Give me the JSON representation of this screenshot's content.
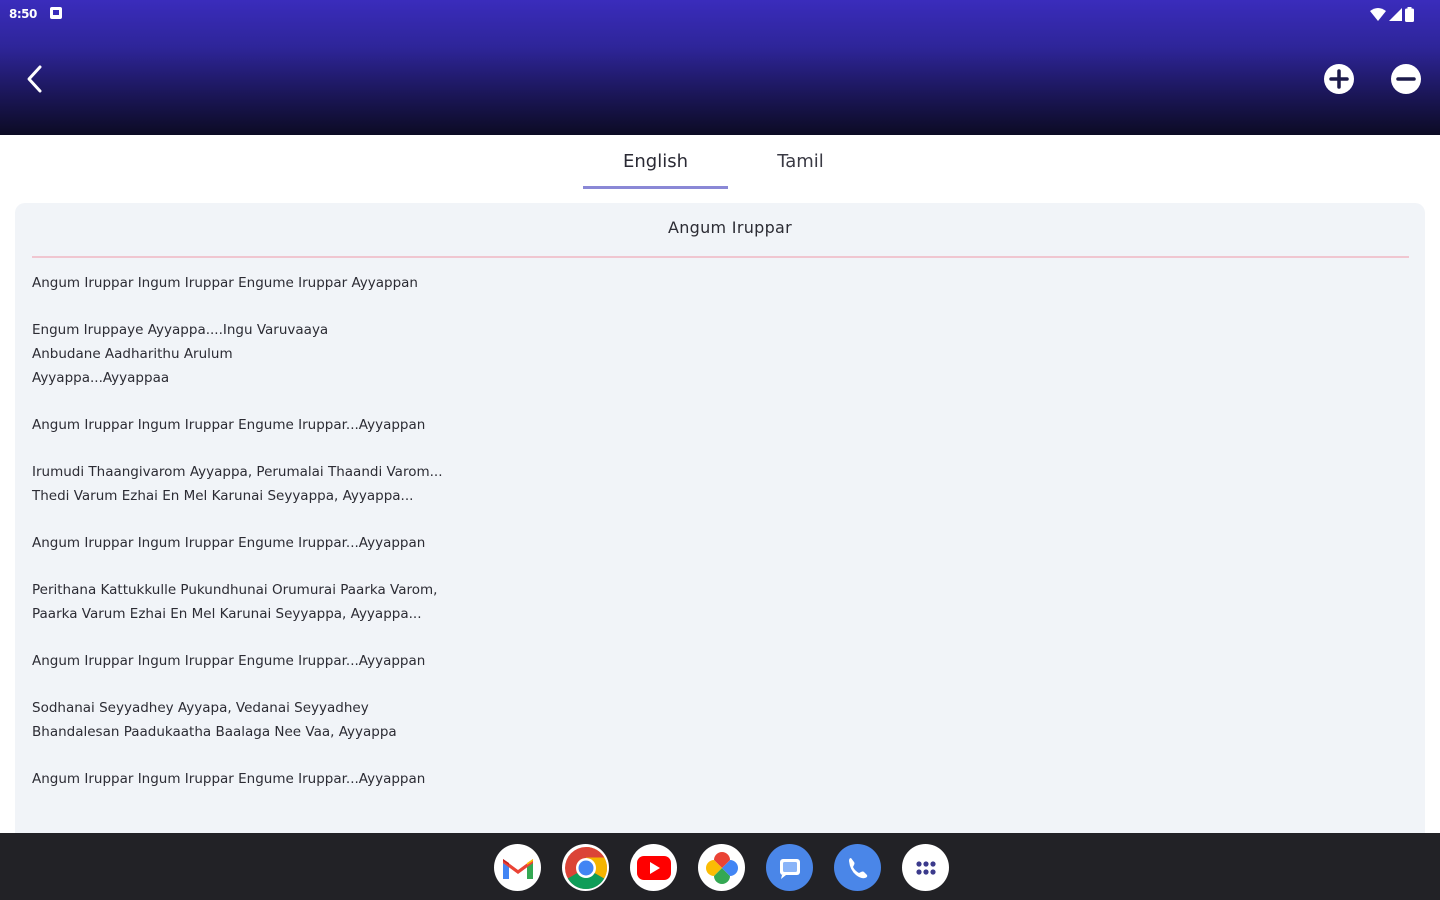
{
  "status_bar": {
    "time": "8:50"
  },
  "tabs": [
    {
      "label": "English",
      "active": true
    },
    {
      "label": "Tamil",
      "active": false
    }
  ],
  "song": {
    "title": "Angum Iruppar",
    "stanzas": [
      [
        "Angum Iruppar Ingum Iruppar Engume Iruppar Ayyappan"
      ],
      [
        "Engum Iruppaye Ayyappa....Ingu Varuvaaya",
        "Anbudane Aadharithu Arulum",
        "Ayyappa...Ayyappaa"
      ],
      [
        "Angum Iruppar Ingum Iruppar Engume Iruppar...Ayyappan"
      ],
      [
        "Irumudi Thaangivarom Ayyappa, Perumalai Thaandi Varom...",
        "Thedi Varum Ezhai En Mel Karunai Seyyappa, Ayyappa..."
      ],
      [
        "Angum Iruppar Ingum Iruppar Engume Iruppar...Ayyappan"
      ],
      [
        "Perithana Kattukkulle Pukundhunai Orumurai Paarka Varom,",
        "Paarka Varum Ezhai En Mel Karunai Seyyappa, Ayyappa..."
      ],
      [
        "Angum Iruppar Ingum Iruppar Engume Iruppar...Ayyappan"
      ],
      [
        "Sodhanai Seyyadhey Ayyapa, Vedanai Seyyadhey",
        "Bhandalesan Paadukaatha Baalaga Nee Vaa, Ayyappa"
      ],
      [
        "Angum Iruppar Ingum Iruppar Engume Iruppar...Ayyappan"
      ]
    ]
  },
  "colors": {
    "header_top": "#3a2cbc",
    "header_bottom": "#0c0b24",
    "tab_indicator": "#8a88d6",
    "card_background": "#f1f4f8",
    "divider": "#f0c6d0",
    "taskbar": "#222226"
  },
  "icons": {
    "back": "chevron-left-icon",
    "zoom_in": "plus-circle-icon",
    "zoom_out": "minus-circle-icon",
    "dock": [
      "gmail-icon",
      "chrome-icon",
      "youtube-icon",
      "photos-icon",
      "messages-icon",
      "phone-icon",
      "app-drawer-icon"
    ]
  }
}
